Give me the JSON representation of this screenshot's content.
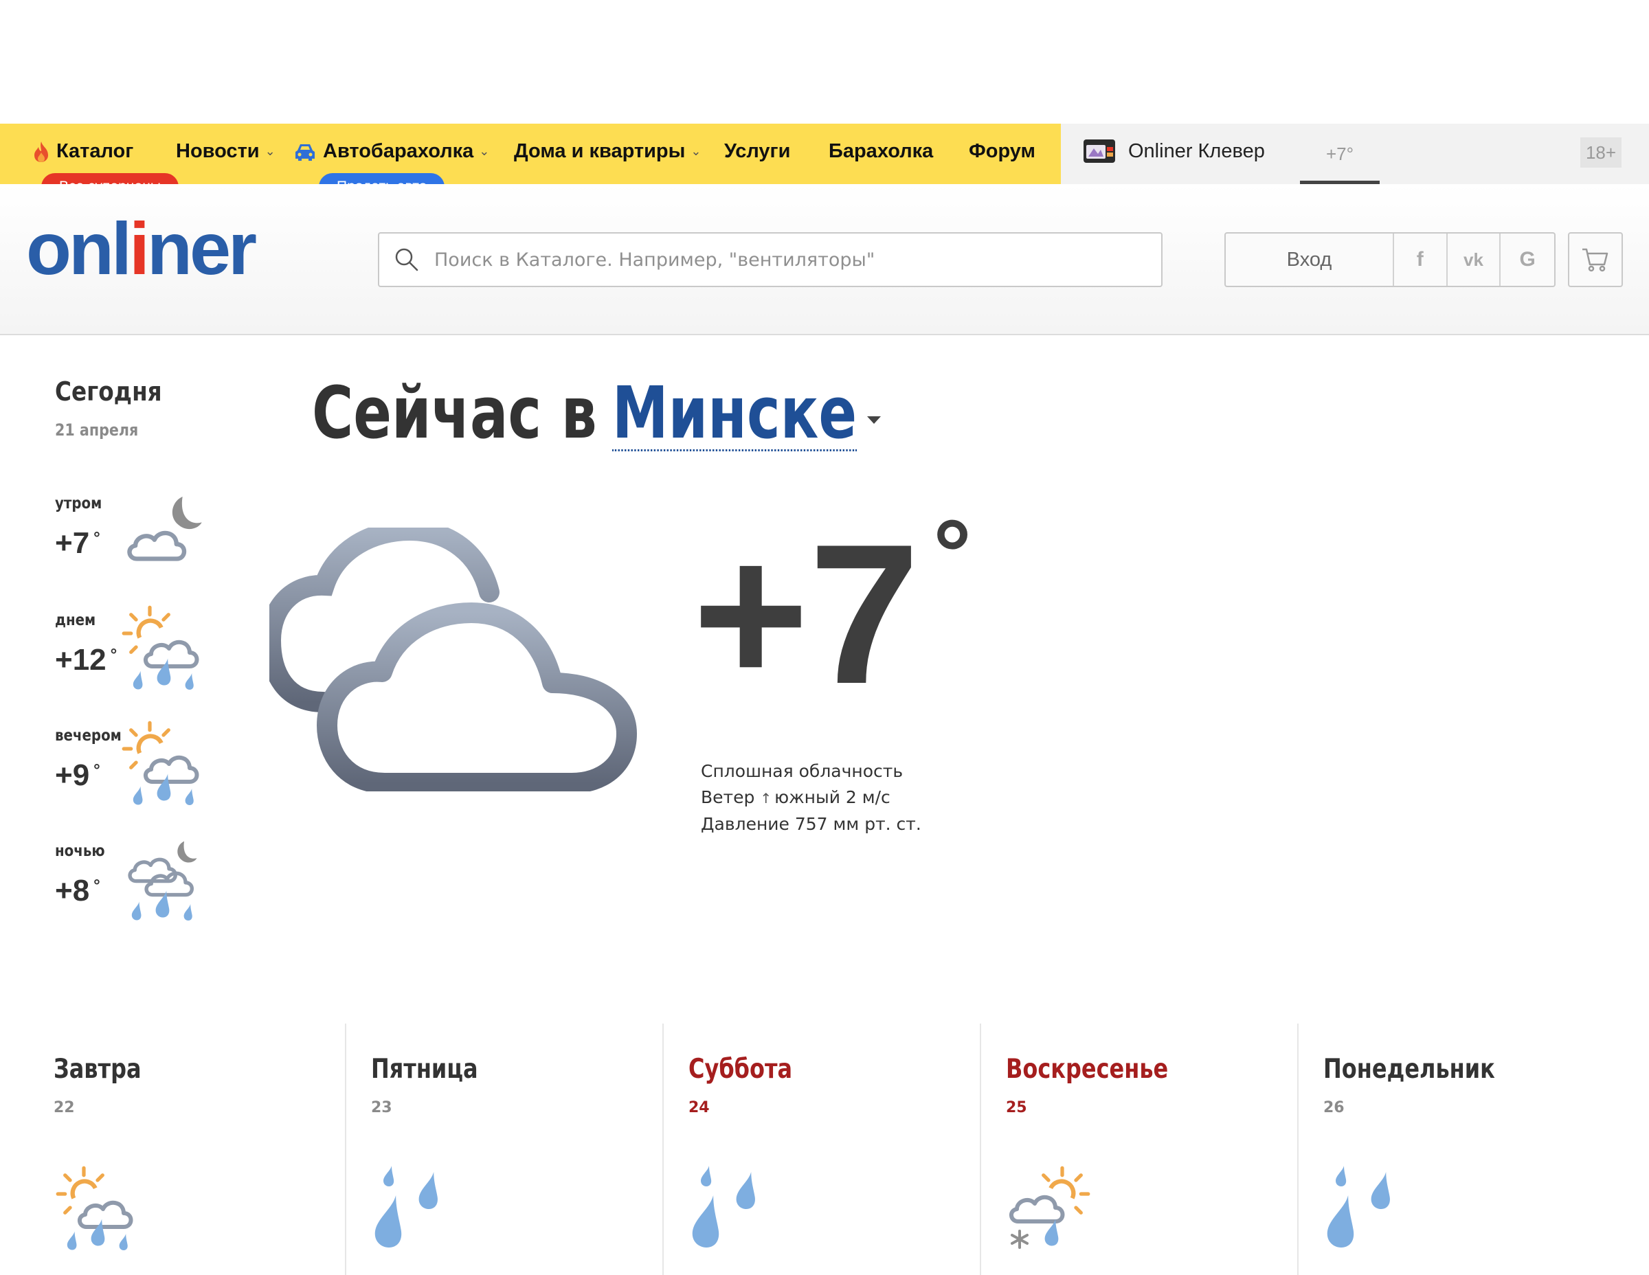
{
  "nav": {
    "items": [
      {
        "label": "Каталог"
      },
      {
        "label": "Новости"
      },
      {
        "label": "Автобарахолка"
      },
      {
        "label": "Дома и квартиры"
      },
      {
        "label": "Услуги"
      },
      {
        "label": "Барахолка"
      },
      {
        "label": "Форум"
      }
    ],
    "badge_catalog": "Все суперцены",
    "badge_auto": "Продать авто",
    "klever_label": "Onliner Клевер",
    "temp": "+7°",
    "age_rating": "18+"
  },
  "header": {
    "logo_parts": [
      "onl",
      "i",
      "ner"
    ],
    "search_placeholder": "Поиск в Каталоге. Например, \"вентиляторы\"",
    "login_label": "Вход",
    "social": [
      "f",
      "vk",
      "G"
    ]
  },
  "today": {
    "title": "Сегодня",
    "date": "21 апреля",
    "parts": [
      {
        "label": "утром",
        "temp": "+7",
        "icon": "night-cloudy-icon"
      },
      {
        "label": "днем",
        "temp": "+12",
        "icon": "sun-cloud-rain-icon"
      },
      {
        "label": "вечером",
        "temp": "+9",
        "icon": "sun-cloud-rain-icon"
      },
      {
        "label": "ночью",
        "temp": "+8",
        "icon": "night-cloud-rain-icon"
      }
    ],
    "degree": "°"
  },
  "now": {
    "prefix": "Сейчас в",
    "city": "Минске",
    "temp": "+7",
    "degree": "°",
    "condition": "Сплошная облачность",
    "wind_label": "Ветер",
    "wind_arrow": "↑",
    "wind_value": "южный 2 м/с",
    "pressure": "Давление 757 мм рт. ст.",
    "icon": "overcast-clouds-icon"
  },
  "forecast": [
    {
      "day": "Завтра",
      "date": "22",
      "weekend": false,
      "icon": "sun-cloud-rain-icon"
    },
    {
      "day": "Пятница",
      "date": "23",
      "weekend": false,
      "icon": "rain-drops-icon"
    },
    {
      "day": "Суббота",
      "date": "24",
      "weekend": true,
      "icon": "rain-drops-icon"
    },
    {
      "day": "Воскресенье",
      "date": "25",
      "weekend": true,
      "icon": "sun-cloud-snow-rain-icon"
    },
    {
      "day": "Понедельник",
      "date": "26",
      "weekend": false,
      "icon": "rain-drops-icon"
    }
  ],
  "colors": {
    "nav_bg": "#fddd52",
    "brand_blue": "#2a5ea8",
    "brand_red": "#e63526",
    "weekend": "#a51e1e",
    "city_link": "#1f4f96",
    "rain": "#7eaee0",
    "sun": "#f0a84a"
  }
}
